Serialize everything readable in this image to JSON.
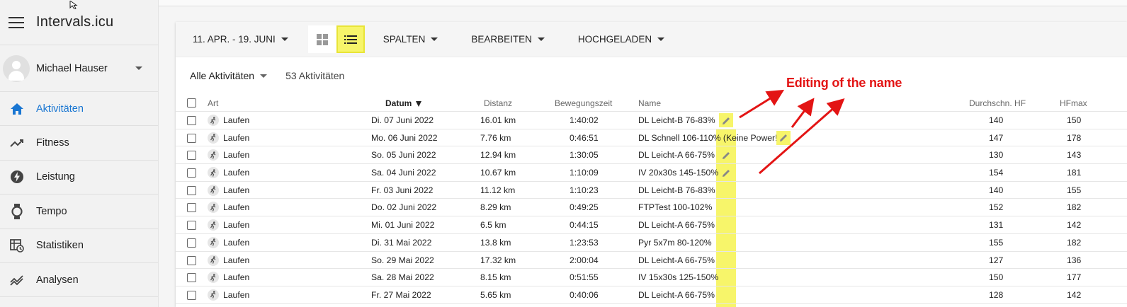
{
  "app": {
    "title": "Intervals.icu"
  },
  "user": {
    "name": "Michael Hauser"
  },
  "nav": [
    {
      "label": "Aktivitäten",
      "icon": "home-icon",
      "active": true
    },
    {
      "label": "Fitness",
      "icon": "trend-icon",
      "active": false
    },
    {
      "label": "Leistung",
      "icon": "bolt-icon",
      "active": false
    },
    {
      "label": "Tempo",
      "icon": "watch-icon",
      "active": false
    },
    {
      "label": "Statistiken",
      "icon": "stats-icon",
      "active": false
    },
    {
      "label": "Analysen",
      "icon": "analysis-icon",
      "active": false
    }
  ],
  "toolbar": {
    "date_range": "11. APR. - 19. JUNI",
    "columns": "SPALTEN",
    "edit": "BEARBEITEN",
    "uploaded": "HOCHGELADEN"
  },
  "filter": {
    "label": "Alle Aktivitäten",
    "count": "53 Aktivitäten"
  },
  "columns": {
    "type": "Art",
    "date": "Datum",
    "distance": "Distanz",
    "moving_time": "Bewegungszeit",
    "name": "Name",
    "avg_hr": "Durchschn. HF",
    "max_hr": "HFmax"
  },
  "rows": [
    {
      "type": "Laufen",
      "date": "Di. 07 Juni 2022",
      "distance": "16.01 km",
      "time": "1:40:02",
      "name": "DL Leicht-B 76-83%",
      "avg_hr": "140",
      "max_hr": "150"
    },
    {
      "type": "Laufen",
      "date": "Mo. 06 Juni 2022",
      "distance": "7.76 km",
      "time": "0:46:51",
      "name": "DL Schnell 106-110% (Keine Power!)",
      "avg_hr": "147",
      "max_hr": "178"
    },
    {
      "type": "Laufen",
      "date": "So. 05 Juni 2022",
      "distance": "12.94 km",
      "time": "1:30:05",
      "name": "DL Leicht-A 66-75%",
      "avg_hr": "130",
      "max_hr": "143"
    },
    {
      "type": "Laufen",
      "date": "Sa. 04 Juni 2022",
      "distance": "10.67 km",
      "time": "1:10:09",
      "name": "IV 20x30s 145-150%",
      "avg_hr": "154",
      "max_hr": "181"
    },
    {
      "type": "Laufen",
      "date": "Fr. 03 Juni 2022",
      "distance": "11.12 km",
      "time": "1:10:23",
      "name": "DL Leicht-B 76-83%",
      "avg_hr": "140",
      "max_hr": "155"
    },
    {
      "type": "Laufen",
      "date": "Do. 02 Juni 2022",
      "distance": "8.29 km",
      "time": "0:49:25",
      "name": "FTPTest 100-102%",
      "avg_hr": "152",
      "max_hr": "182"
    },
    {
      "type": "Laufen",
      "date": "Mi. 01 Juni 2022",
      "distance": "6.5 km",
      "time": "0:44:15",
      "name": "DL Leicht-A 66-75%",
      "avg_hr": "131",
      "max_hr": "142"
    },
    {
      "type": "Laufen",
      "date": "Di. 31 Mai 2022",
      "distance": "13.8 km",
      "time": "1:23:53",
      "name": "Pyr 5x7m 80-120%",
      "avg_hr": "155",
      "max_hr": "182"
    },
    {
      "type": "Laufen",
      "date": "So. 29 Mai 2022",
      "distance": "17.32 km",
      "time": "2:00:04",
      "name": "DL Leicht-A 66-75%",
      "avg_hr": "127",
      "max_hr": "136"
    },
    {
      "type": "Laufen",
      "date": "Sa. 28 Mai 2022",
      "distance": "8.15 km",
      "time": "0:51:55",
      "name": "IV 15x30s 125-150%",
      "avg_hr": "150",
      "max_hr": "177"
    },
    {
      "type": "Laufen",
      "date": "Fr. 27 Mai 2022",
      "distance": "5.65 km",
      "time": "0:40:06",
      "name": "DL Leicht-A 66-75%",
      "avg_hr": "128",
      "max_hr": "142"
    }
  ],
  "annotation": {
    "text": "Editing of the name",
    "color": "#e31414"
  },
  "colors": {
    "accent": "#1976d2",
    "highlight": "#f7f56a"
  }
}
